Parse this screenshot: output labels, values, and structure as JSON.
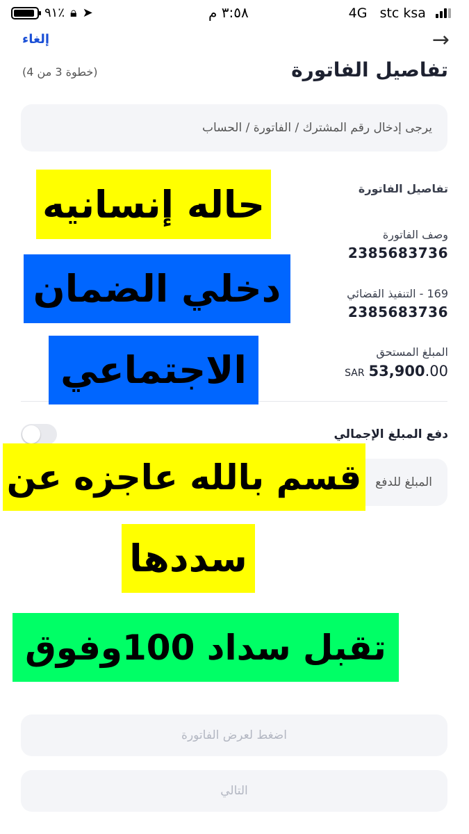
{
  "status_bar": {
    "carrier": "stc ksa",
    "network": "4G",
    "time": "٣:٥٨ م",
    "battery": "٩١٪",
    "battery_level": 0.91
  },
  "header": {
    "cancel_label": "إلغاء",
    "back_icon": "arrow-right-icon",
    "title": "تفاصيل الفاتورة",
    "step": "(خطوة 3 من 4)"
  },
  "breadcrumb": {
    "text": "يرجى إدخال رقم المشترك / الفاتورة / الحساب"
  },
  "details": {
    "section_title": "تفاصيل الفاتورة",
    "bill_description_label": "وصف الفاتورة",
    "bill_description_value": "2385683736",
    "enforcement_label": "169 - التنفيذ القضائي",
    "enforcement_value": "2385683736",
    "amount_due_label": "المبلغ المستحق",
    "amount_due_currency": "SAR",
    "amount_due_main": "53,900",
    "amount_due_decimal": ".00"
  },
  "pay_total": {
    "label": "دفع المبلغ الإجمالي",
    "enabled": false
  },
  "amount_field": {
    "placeholder": "المبلغ للدفع"
  },
  "buttons": {
    "view_bill": "اضغط لعرض الفاتورة",
    "next": "التالي"
  },
  "overlay_text": {
    "line1": "حاله إنسانيه",
    "line2": "دخلي الضمان",
    "line3": "الاجتماعي",
    "line4": "قسم بالله عاجزه عن",
    "line5": "سددها",
    "line6": "تقبل سداد 100وفوق"
  },
  "colors": {
    "accent_link": "#1a4fd6",
    "sticker_yellow": "#ffff00",
    "sticker_blue": "#0066ff",
    "sticker_green": "#00ff66"
  }
}
